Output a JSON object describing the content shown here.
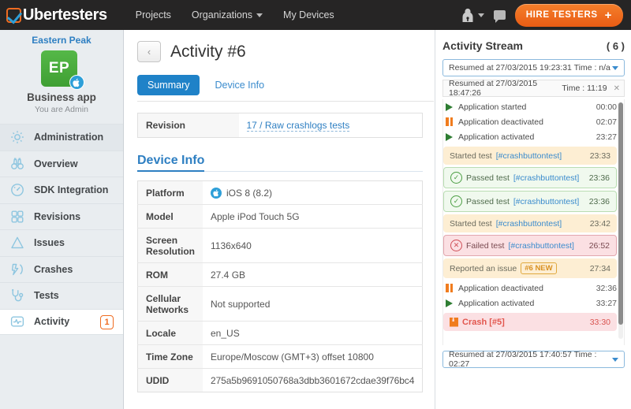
{
  "topbar": {
    "brand": "Ubertesters",
    "nav": [
      {
        "label": "Projects",
        "caret": false
      },
      {
        "label": "Organizations",
        "caret": true
      },
      {
        "label": "My Devices",
        "caret": false
      }
    ],
    "user_icon": "user-icon",
    "chat_icon": "chat-icon",
    "hire_label": "HIRE TESTERS",
    "hire_plus": "+",
    "accent": "#ef6c21"
  },
  "sidebar": {
    "team": "Eastern Peak",
    "app_initials": "EP",
    "os_glyph": "",
    "app_name": "Business app",
    "role": "You are Admin",
    "items": [
      {
        "label": "Administration",
        "icon": "gear-icon",
        "badge": null,
        "active": false,
        "shade": true
      },
      {
        "label": "Overview",
        "icon": "binoculars-icon",
        "badge": null,
        "active": false,
        "shade": false
      },
      {
        "label": "SDK Integration",
        "icon": "gauge-icon",
        "badge": null,
        "active": false,
        "shade": false
      },
      {
        "label": "Revisions",
        "icon": "grid-icon",
        "badge": null,
        "active": false,
        "shade": false
      },
      {
        "label": "Issues",
        "icon": "warning-triangle-icon",
        "badge": null,
        "active": false,
        "shade": false
      },
      {
        "label": "Crashes",
        "icon": "crash-icon",
        "badge": null,
        "active": false,
        "shade": false
      },
      {
        "label": "Tests",
        "icon": "stethoscope-icon",
        "badge": null,
        "active": false,
        "shade": false
      },
      {
        "label": "Activity",
        "icon": "activity-pulse-icon",
        "badge": "1",
        "active": true,
        "shade": false
      }
    ]
  },
  "main": {
    "back_glyph": "‹",
    "title": "Activity #6",
    "tabs": [
      {
        "label": "Summary",
        "active": true
      },
      {
        "label": "Device Info",
        "active": false
      }
    ],
    "revision": {
      "key": "Revision",
      "value": "17 / Raw crashlogs tests"
    },
    "device_info_title": "Device Info",
    "device_rows": [
      {
        "key": "Platform",
        "value": "iOS 8 (8.2)",
        "icon": "apple-icon"
      },
      {
        "key": "Model",
        "value": "Apple iPod Touch 5G",
        "icon": null
      },
      {
        "key": "Screen Resolution",
        "value": "1136x640",
        "icon": null
      },
      {
        "key": "ROM",
        "value": "27.4 GB",
        "icon": null
      },
      {
        "key": "Cellular Networks",
        "value": "Not supported",
        "icon": null
      },
      {
        "key": "Locale",
        "value": "en_US",
        "icon": null
      },
      {
        "key": "Time Zone",
        "value": "Europe/Moscow (GMT+3) offset 10800",
        "icon": null
      },
      {
        "key": "UDID",
        "value": "275a5b9691050768a3dbb3601672cdae39f76bc4",
        "icon": null
      }
    ]
  },
  "stream": {
    "title": "Activity Stream",
    "count": "( 6 )",
    "top_select": "Resumed at 27/03/2015 19:23:31 Time : n/a",
    "bottom_select": "Resumed at 27/03/2015 17:40:57 Time : 02:27",
    "session": {
      "label": "Resumed at 27/03/2015 18:47:26",
      "time": "Time : 11:19",
      "close": "✕"
    },
    "events": [
      {
        "kind": "plain",
        "icon": "play-icon",
        "text": "Application started",
        "time": "00:00"
      },
      {
        "kind": "plain",
        "icon": "pause-icon",
        "text": "Application deactivated",
        "time": "02:07"
      },
      {
        "kind": "plain",
        "icon": "play-icon",
        "text": "Application activated",
        "time": "23:27"
      },
      {
        "kind": "started",
        "icon": null,
        "text": "Started  test",
        "tag": "[#crashbuttontest]",
        "time": "23:33"
      },
      {
        "kind": "passed",
        "icon": "check-circle-icon",
        "text": "Passed  test",
        "tag": "[#crashbuttontest]",
        "time": "23:36"
      },
      {
        "kind": "passed",
        "icon": "check-circle-icon",
        "text": "Passed  test",
        "tag": "[#crashbuttontest]",
        "time": "23:36"
      },
      {
        "kind": "started",
        "icon": null,
        "text": "Started  test",
        "tag": "[#crashbuttontest]",
        "time": "23:42"
      },
      {
        "kind": "failed",
        "icon": "x-circle-icon",
        "text": "Failed  test",
        "tag": "[#crashbuttontest]",
        "time": "26:52"
      },
      {
        "kind": "issue",
        "icon": null,
        "text": "Reported an issue",
        "tag": "#6 NEW",
        "time": "27:34"
      },
      {
        "kind": "plain",
        "icon": "pause-icon",
        "text": "Application deactivated",
        "time": "32:36"
      },
      {
        "kind": "plain",
        "icon": "play-icon",
        "text": "Application activated",
        "time": "33:27"
      },
      {
        "kind": "crash",
        "icon": "crash-icon",
        "text": "Crash [#5]",
        "time": "33:30"
      }
    ]
  }
}
